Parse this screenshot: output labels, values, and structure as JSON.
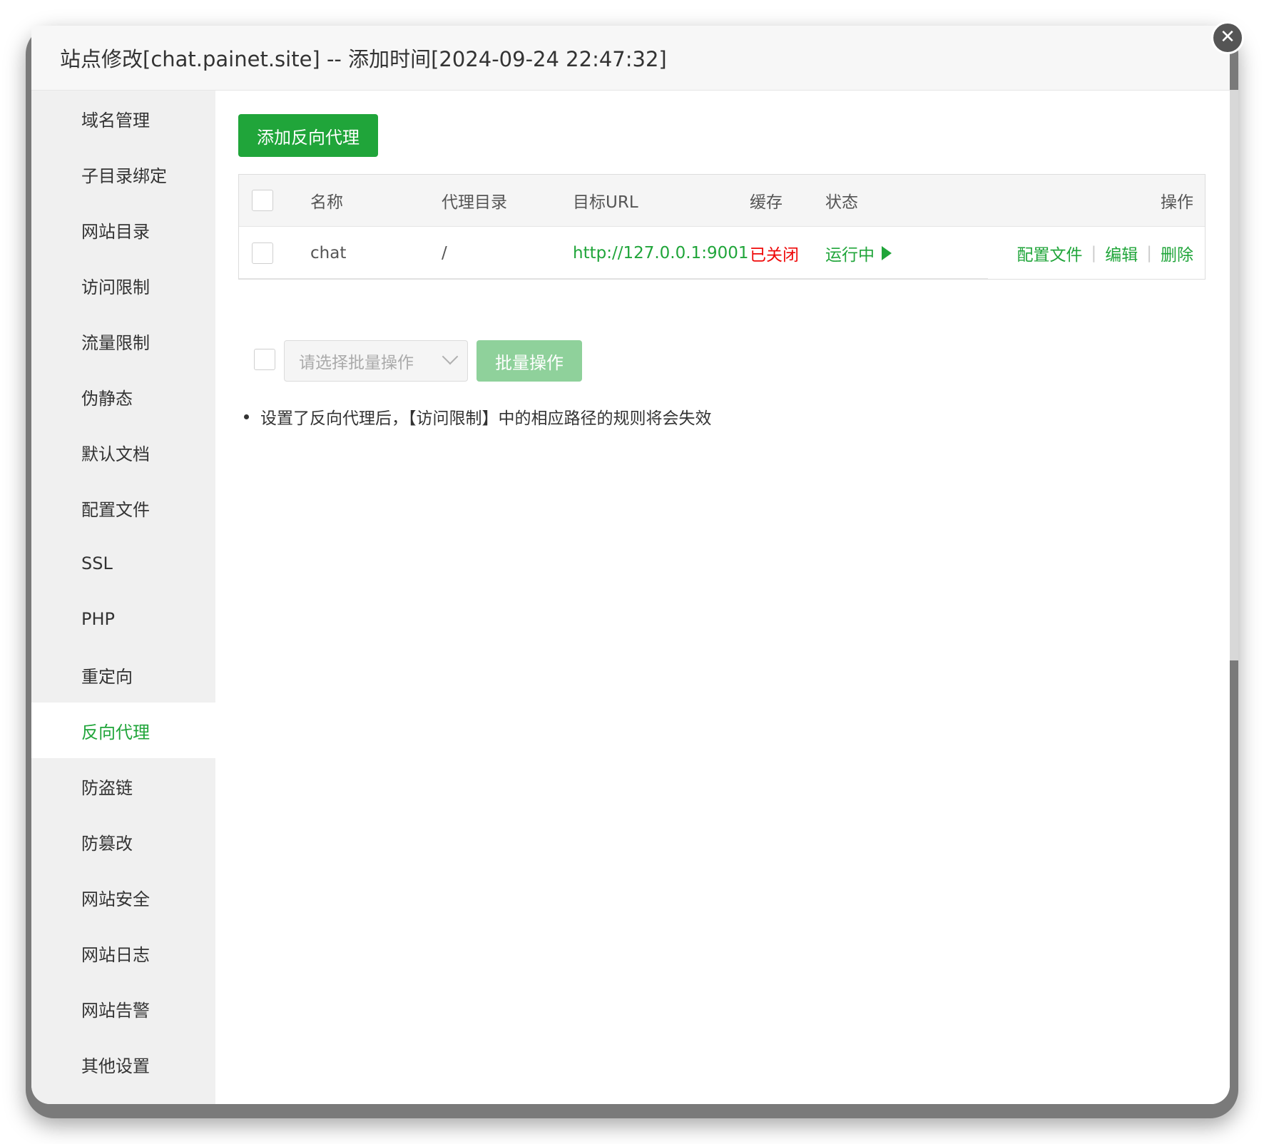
{
  "dialog": {
    "title": "站点修改[chat.painet.site] -- 添加时间[2024-09-24 22:47:32]",
    "close_icon": "✕"
  },
  "sidebar": {
    "items": [
      {
        "label": "域名管理"
      },
      {
        "label": "子目录绑定"
      },
      {
        "label": "网站目录"
      },
      {
        "label": "访问限制"
      },
      {
        "label": "流量限制"
      },
      {
        "label": "伪静态"
      },
      {
        "label": "默认文档"
      },
      {
        "label": "配置文件"
      },
      {
        "label": "SSL"
      },
      {
        "label": "PHP"
      },
      {
        "label": "重定向"
      },
      {
        "label": "反向代理"
      },
      {
        "label": "防盗链"
      },
      {
        "label": "防篡改"
      },
      {
        "label": "网站安全"
      },
      {
        "label": "网站日志"
      },
      {
        "label": "网站告警"
      },
      {
        "label": "其他设置"
      }
    ],
    "active": "反向代理"
  },
  "main": {
    "add_button": "添加反向代理",
    "table": {
      "headers": {
        "name": "名称",
        "dir": "代理目录",
        "url": "目标URL",
        "cache": "缓存",
        "status": "状态",
        "ops": "操作"
      },
      "rows": [
        {
          "name": "chat",
          "dir": "/",
          "url": "http://127.0.0.1:9001",
          "cache": "已关闭",
          "status": "运行中",
          "op_config": "配置文件",
          "op_edit": "编辑",
          "op_delete": "删除",
          "separator": "|"
        }
      ]
    },
    "batch": {
      "select_placeholder": "请选择批量操作",
      "button": "批量操作"
    },
    "tip": "设置了反向代理后，【访问限制】中的相应路径的规则将会失效"
  },
  "colors": {
    "accent": "#20a53a",
    "danger": "#ef0808",
    "batch_disabled": "#8fd19b"
  }
}
